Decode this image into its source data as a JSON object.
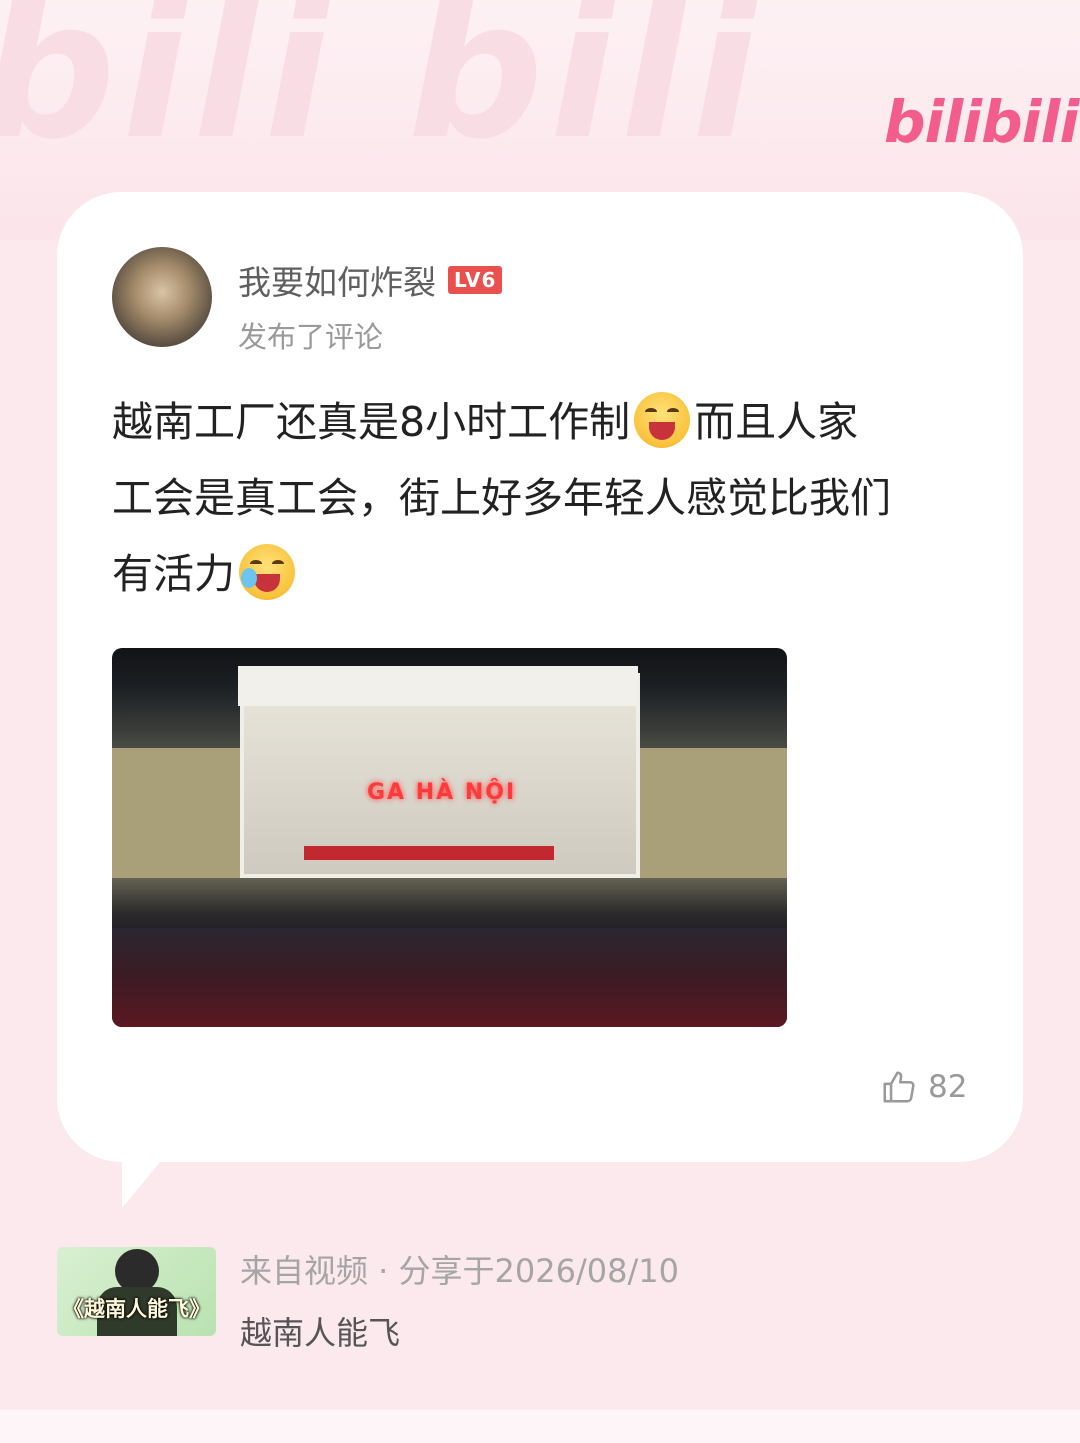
{
  "brand": {
    "logo": "bilibili",
    "accent": "#f25d8e",
    "watermark": "bili bili"
  },
  "comment_card": {
    "username": "我要如何炸裂",
    "level": "LV6",
    "action": "发布了评论",
    "text_line1a": "越南工厂还真是8小时工作制",
    "text_line1b": "而且人家",
    "text_line2": "工会是真工会，街上好多年轻人感觉比我们",
    "text_line3": "有活力",
    "emoji1": "laugh-emoji-icon",
    "emoji2": "cry-laugh-emoji-icon",
    "photo_sign": "GA HÀ NỘI",
    "like_count": "82"
  },
  "source": {
    "meta": "来自视频 · 分享于2026/08/10",
    "title": "越南人能飞",
    "thumbnail_text": "《越南人能飞》"
  }
}
